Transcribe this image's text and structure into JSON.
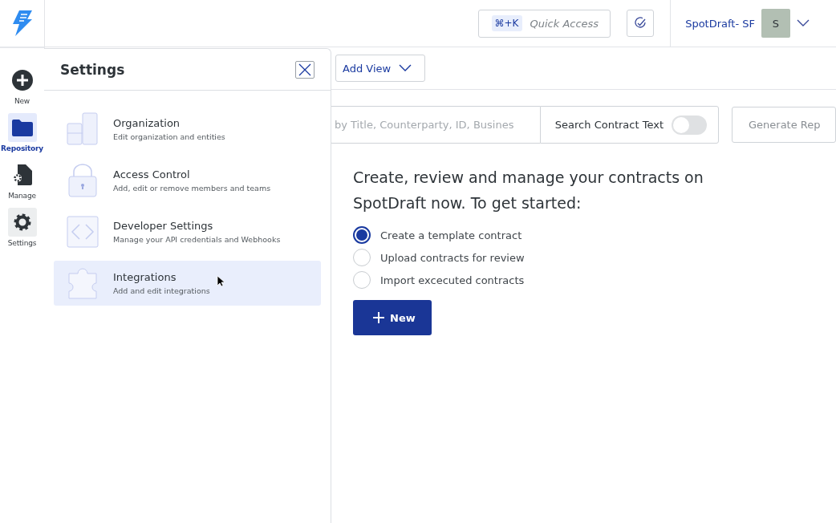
{
  "rail": {
    "items": [
      {
        "label": "New",
        "kind": "new",
        "selected": false
      },
      {
        "label": "Repository",
        "kind": "folder",
        "selected": true
      },
      {
        "label": "Manage",
        "kind": "manage",
        "selected": false
      },
      {
        "label": "Settings",
        "kind": "gear",
        "selected": false
      }
    ]
  },
  "topbar": {
    "shortcut": "⌘+K",
    "quick_access": "Quick Access",
    "workspace": "SpotDraft- SF",
    "avatar": "S"
  },
  "toolbar": {
    "add_view": "Add View"
  },
  "search": {
    "placeholder": "by Title, Counterparty, ID, Busines",
    "toggle_label": "Search Contract Text",
    "toggle_on": false,
    "generate": "Generate Rep"
  },
  "intro": {
    "heading": "Create, review and manage your contracts on SpotDraft now. To get started:",
    "options": [
      {
        "label": "Create a template contract",
        "selected": true
      },
      {
        "label": "Upload contracts for review",
        "selected": false
      },
      {
        "label": "Import excecuted contracts",
        "selected": false
      }
    ],
    "new_button": "New"
  },
  "settings_panel": {
    "title": "Settings",
    "items": [
      {
        "kind": "organization",
        "title": "Organization",
        "subtitle": "Edit organization and entities",
        "selected": false
      },
      {
        "kind": "access",
        "title": "Access Control",
        "subtitle": "Add, edit or remove members and teams",
        "selected": false
      },
      {
        "kind": "developer",
        "title": "Developer Settings",
        "subtitle": "Manage your API credentials and Webhooks",
        "selected": false
      },
      {
        "kind": "integrations",
        "title": "Integrations",
        "subtitle": "Add and edit integrations",
        "selected": true
      }
    ]
  }
}
